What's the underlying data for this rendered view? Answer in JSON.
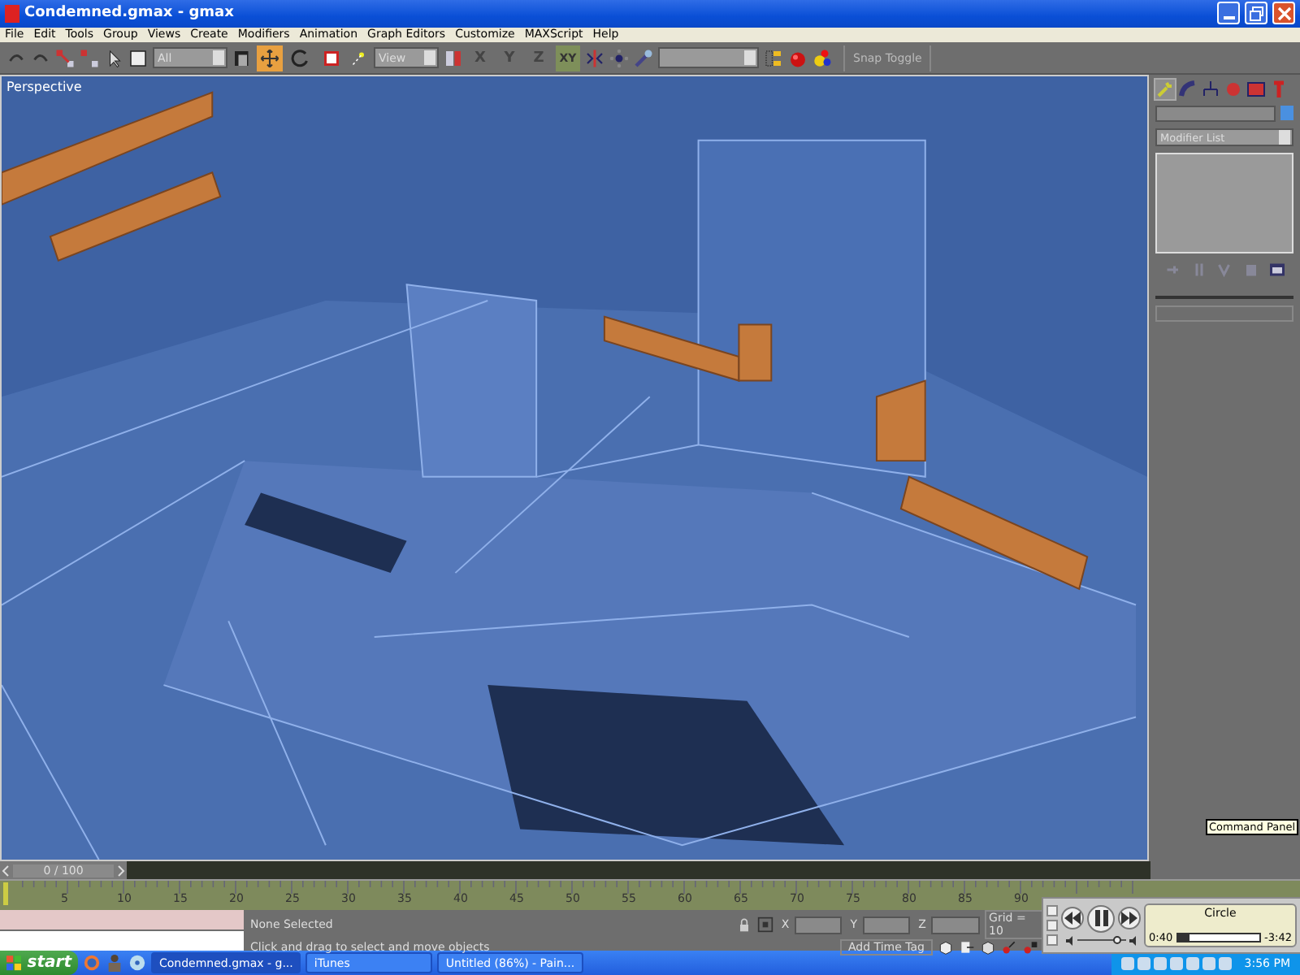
{
  "window": {
    "title": "Condemned.gmax - gmax"
  },
  "menu": [
    "File",
    "Edit",
    "Tools",
    "Group",
    "Views",
    "Create",
    "Modifiers",
    "Animation",
    "Graph Editors",
    "Customize",
    "MAXScript",
    "Help"
  ],
  "toolbar": {
    "selection_filter": "All",
    "transform_tools": [
      {
        "selected": true
      },
      {
        "selected": false
      },
      {
        "selected": false
      }
    ],
    "reference_coord": "View",
    "axis_buttons": [
      {
        "label": "X",
        "selected": false
      },
      {
        "label": "Y",
        "selected": false
      },
      {
        "label": "Z",
        "selected": false
      },
      {
        "label": "XY",
        "selected": true
      }
    ],
    "snap_toggle": "Snap Toggle"
  },
  "viewport": {
    "label": "Perspective"
  },
  "command_panel": {
    "tabs": [
      {
        "selected": true
      },
      {
        "selected": false
      },
      {
        "selected": false
      },
      {
        "selected": false
      },
      {
        "selected": false
      },
      {
        "selected": false
      }
    ],
    "modifier_list": "Modifier List",
    "tooltip": "Command Panel"
  },
  "timeline": {
    "slider": "0 / 100",
    "ticks": [
      "5",
      "10",
      "15",
      "20",
      "25",
      "30",
      "35",
      "40",
      "45",
      "50",
      "55",
      "60",
      "65",
      "70",
      "75",
      "80",
      "85",
      "90"
    ]
  },
  "status": {
    "selection": "None Selected",
    "prompt": "Click and drag to select and move objects",
    "x_label": "X",
    "y_label": "Y",
    "z_label": "Z",
    "grid": "Grid = 10",
    "time_tag": "Add Time Tag"
  },
  "itunes": {
    "track": "Circle",
    "elapsed": "0:40",
    "remaining": "-3:42",
    "level": 0.15,
    "volume": {
      "level": 0.8
    }
  },
  "taskbar": {
    "start": "start",
    "tasks": [
      {
        "label": "Condemned.gmax - g...",
        "selected": true
      },
      {
        "label": "iTunes",
        "selected": false
      },
      {
        "label": "Untitled (86%) - Pain...",
        "selected": false
      }
    ],
    "clock": "3:56 PM"
  }
}
